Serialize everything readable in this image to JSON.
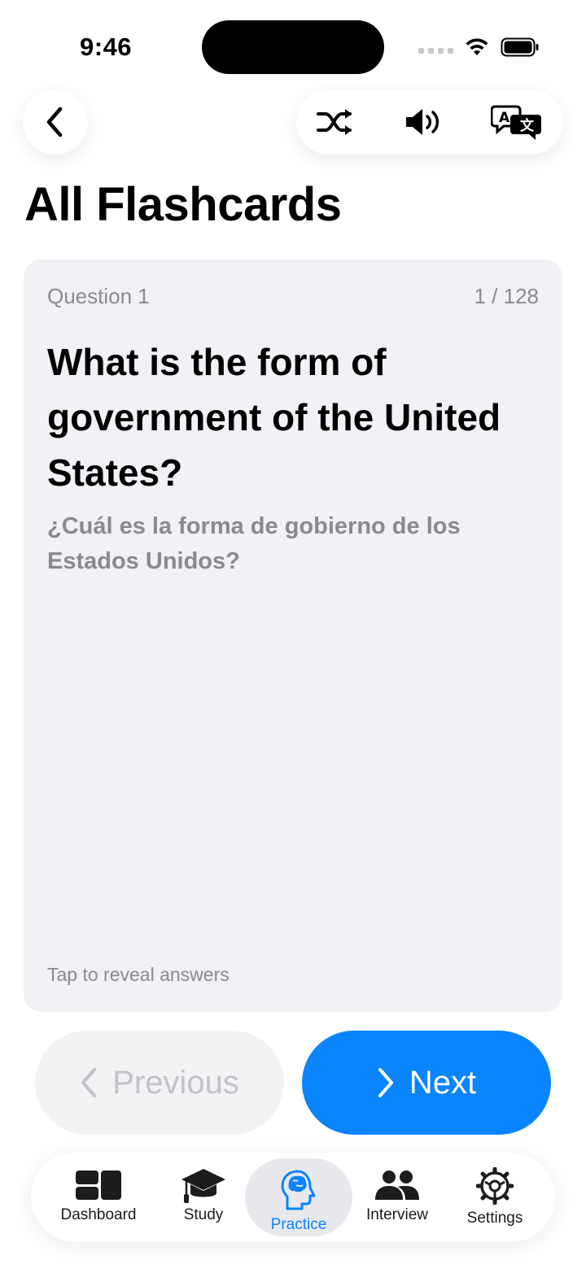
{
  "status_bar": {
    "time": "9:46"
  },
  "header": {
    "title": "All Flashcards"
  },
  "card": {
    "question_label": "Question 1",
    "counter": "1 / 128",
    "question": "What is the form of government of the United States?",
    "translation": "¿Cuál es la forma de gobierno de los Estados Unidos?",
    "hint": "Tap to reveal answers"
  },
  "navigation": {
    "previous_label": "Previous",
    "next_label": "Next"
  },
  "tabs": [
    {
      "label": "Dashboard",
      "icon": "dashboard-icon",
      "active": false
    },
    {
      "label": "Study",
      "icon": "graduation-cap-icon",
      "active": false
    },
    {
      "label": "Practice",
      "icon": "brain-head-icon",
      "active": true
    },
    {
      "label": "Interview",
      "icon": "people-icon",
      "active": false
    },
    {
      "label": "Settings",
      "icon": "gear-icon",
      "active": false
    }
  ],
  "colors": {
    "accent": "#0a84ff",
    "card_bg": "#f1f1f6",
    "secondary_text": "#8a8a8e"
  }
}
